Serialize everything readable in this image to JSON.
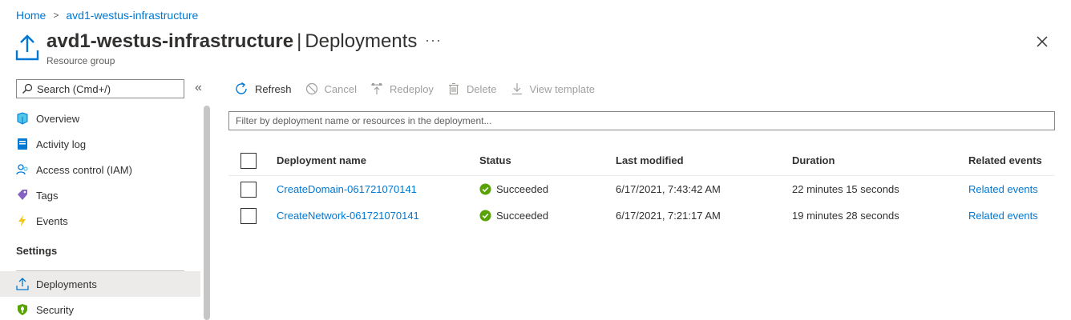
{
  "breadcrumb": {
    "home": "Home",
    "current": "avd1-westus-infrastructure"
  },
  "header": {
    "resource_name": "avd1-westus-infrastructure",
    "separator": "|",
    "page_name": "Deployments",
    "subtitle": "Resource group",
    "more": "···"
  },
  "sidebar": {
    "search_placeholder": "Search (Cmd+/)",
    "collapse": "«",
    "items": [
      {
        "label": "Overview",
        "icon": "overview-icon"
      },
      {
        "label": "Activity log",
        "icon": "activity-log-icon"
      },
      {
        "label": "Access control (IAM)",
        "icon": "iam-icon"
      },
      {
        "label": "Tags",
        "icon": "tag-icon"
      },
      {
        "label": "Events",
        "icon": "lightning-icon"
      }
    ],
    "section_settings": "Settings",
    "settings_items": [
      {
        "label": "Deployments",
        "icon": "deployments-icon",
        "active": true
      },
      {
        "label": "Security",
        "icon": "shield-icon"
      }
    ]
  },
  "toolbar": {
    "refresh": "Refresh",
    "cancel": "Cancel",
    "redeploy": "Redeploy",
    "delete": "Delete",
    "view_template": "View template"
  },
  "filter": {
    "placeholder": "Filter by deployment name or resources in the deployment..."
  },
  "table": {
    "columns": [
      "Deployment name",
      "Status",
      "Last modified",
      "Duration",
      "Related events"
    ],
    "rows": [
      {
        "name": "CreateDomain-061721070141",
        "status": "Succeeded",
        "modified": "6/17/2021, 7:43:42 AM",
        "duration": "22 minutes 15 seconds",
        "events": "Related events"
      },
      {
        "name": "CreateNetwork-061721070141",
        "status": "Succeeded",
        "modified": "6/17/2021, 7:21:17 AM",
        "duration": "19 minutes 28 seconds",
        "events": "Related events"
      }
    ]
  },
  "colors": {
    "accent": "#0078d4",
    "success": "#57a300",
    "text": "#323130",
    "disabled": "#a19f9d"
  }
}
